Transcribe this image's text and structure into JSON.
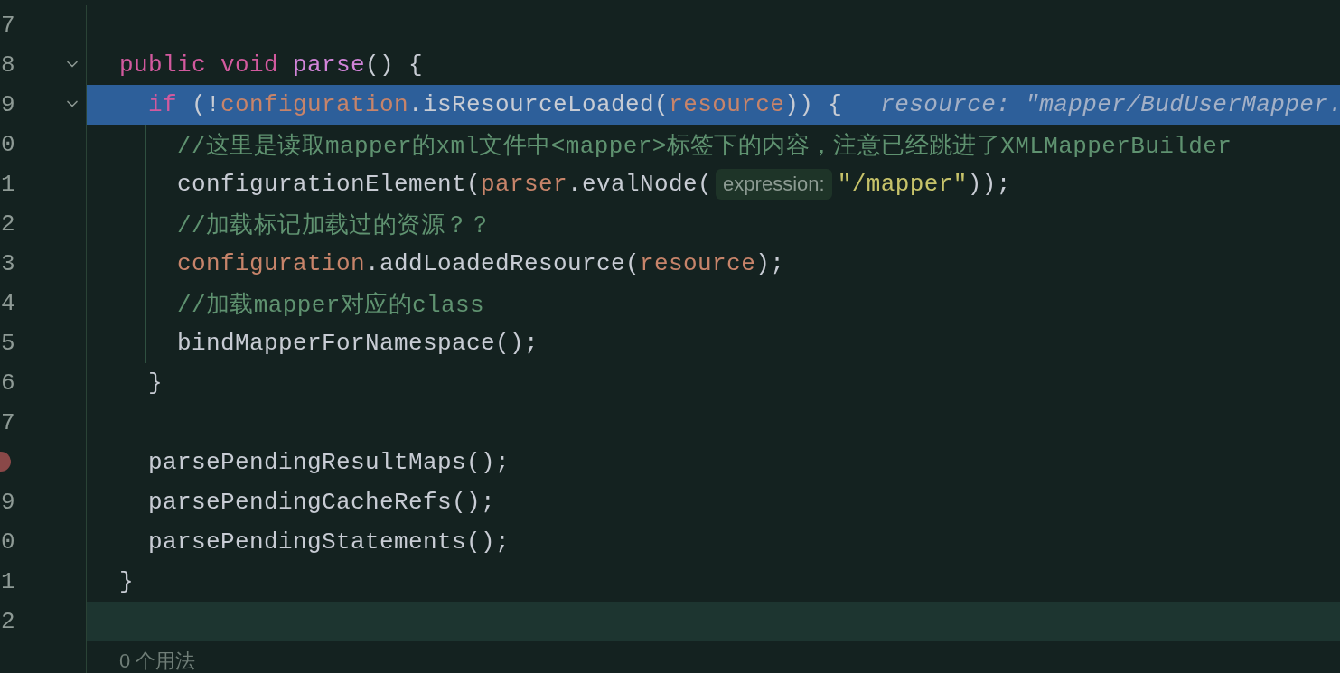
{
  "editor": {
    "lines": [
      {
        "number": "7"
      },
      {
        "number": "8",
        "expanded": true,
        "tokens": [
          {
            "kind": "keyword",
            "text": "public "
          },
          {
            "kind": "keyword",
            "text": "void "
          },
          {
            "kind": "declaration",
            "text": "parse"
          },
          {
            "kind": "plain",
            "text": "() {"
          }
        ],
        "children": [
          {
            "number": "9",
            "expanded": true,
            "selected": true,
            "tokens": [
              {
                "kind": "keyword",
                "text": "if "
              },
              {
                "kind": "plain",
                "text": "(!"
              },
              {
                "kind": "field",
                "text": "configuration"
              },
              {
                "kind": "plain",
                "text": ".isResourceLoaded("
              },
              {
                "kind": "field",
                "text": "resource"
              },
              {
                "kind": "plain",
                "text": ")) {"
              },
              {
                "kind": "value_hint",
                "text": "resource: \"mapper/BudUserMapper."
              }
            ],
            "children": [
              {
                "number": "0",
                "tokens": [
                  {
                    "kind": "comment",
                    "text": "//这里是读取mapper的xml文件中<mapper>标签下的内容，注意已经跳进了XMLMapperBuilder"
                  }
                ]
              },
              {
                "number": "1",
                "tokens": [
                  {
                    "kind": "plain",
                    "text": "configurationElement("
                  },
                  {
                    "kind": "field",
                    "text": "parser"
                  },
                  {
                    "kind": "plain",
                    "text": ".evalNode("
                  },
                  {
                    "kind": "param_hint",
                    "text": "expression:"
                  },
                  {
                    "kind": "string",
                    "text": "\"/mapper\""
                  },
                  {
                    "kind": "plain",
                    "text": "));"
                  }
                ]
              },
              {
                "number": "2",
                "tokens": [
                  {
                    "kind": "comment",
                    "text": "//加载标记加载过的资源？？"
                  }
                ]
              },
              {
                "number": "3",
                "tokens": [
                  {
                    "kind": "field",
                    "text": "configuration"
                  },
                  {
                    "kind": "plain",
                    "text": ".addLoadedResource("
                  },
                  {
                    "kind": "field",
                    "text": "resource"
                  },
                  {
                    "kind": "plain",
                    "text": ");"
                  }
                ]
              },
              {
                "number": "4",
                "tokens": [
                  {
                    "kind": "comment",
                    "text": "//加载mapper对应的class"
                  }
                ]
              },
              {
                "number": "5",
                "tokens": [
                  {
                    "kind": "plain",
                    "text": "bindMapperForNamespace();"
                  }
                ]
              }
            ]
          },
          {
            "number": "6",
            "tokens": [
              {
                "kind": "plain",
                "text": "}"
              }
            ]
          },
          {
            "number": "7"
          },
          {
            "breakpoint": true,
            "tokens": [
              {
                "kind": "plain",
                "text": "parsePendingResultMaps();"
              }
            ]
          },
          {
            "number": "9",
            "tokens": [
              {
                "kind": "plain",
                "text": "parsePendingCacheRefs();"
              }
            ]
          },
          {
            "number": "0",
            "tokens": [
              {
                "kind": "plain",
                "text": "parsePendingStatements();"
              }
            ]
          }
        ]
      },
      {
        "number": "1",
        "tokens": [
          {
            "kind": "plain",
            "text": "}"
          }
        ]
      },
      {
        "number": "2",
        "current": true
      }
    ],
    "usage_hint": "0 个用法"
  }
}
